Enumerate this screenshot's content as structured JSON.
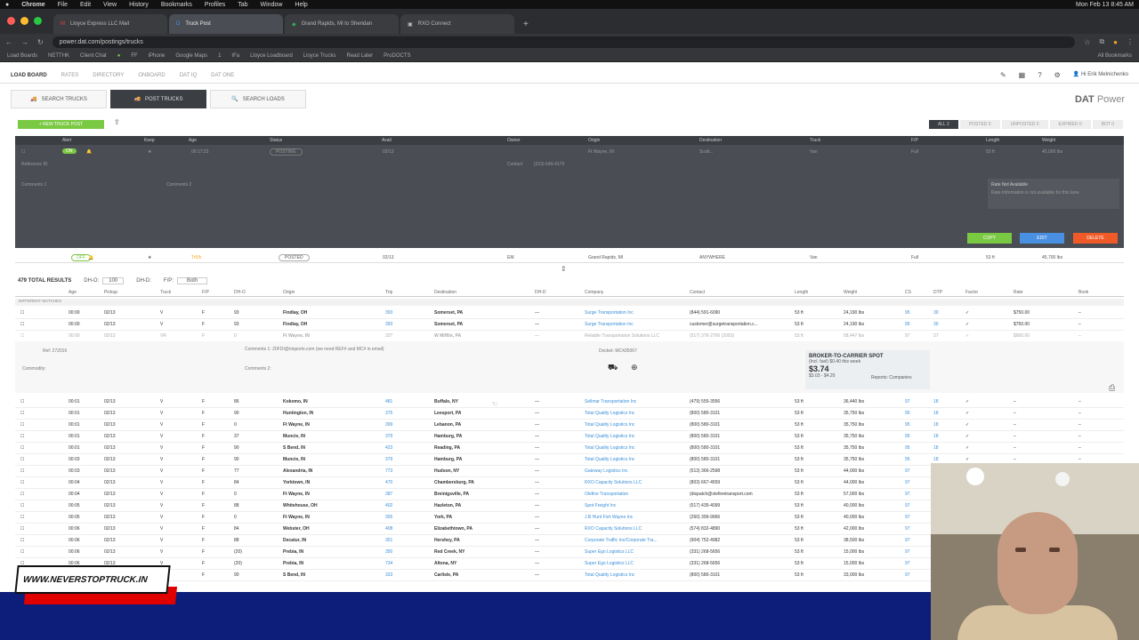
{
  "mac_menu": {
    "apple": "",
    "app": "Chrome",
    "items": [
      "File",
      "Edit",
      "View",
      "History",
      "Bookmarks",
      "Profiles",
      "Tab",
      "Window",
      "Help"
    ],
    "clock": "Mon Feb 13  8:45 AM"
  },
  "tabs": [
    {
      "label": "Lloyce Express LLC Mail",
      "active": false
    },
    {
      "label": "Truck Post",
      "active": true
    },
    {
      "label": "Grand Rapids, MI to Sheridan",
      "active": false
    },
    {
      "label": "RXO Connect",
      "active": false
    }
  ],
  "address": "power.dat.com/postings/trucks",
  "bookmarks": [
    "Load Boards",
    "NETTHK",
    "Client Chat",
    "",
    "FF",
    "iPhone",
    "Google Maps",
    "1",
    "IFa",
    "Lloyce Loadboard",
    "Lloyce Trucks",
    "Read Later",
    "ProDOCTS"
  ],
  "bookmarks_all": "All Bookmarks",
  "nav": {
    "items": [
      "LOAD BOARD",
      "RATES",
      "DIRECTORY",
      "ONBOARD",
      "DAT IQ",
      "DAT ONE"
    ],
    "user": "Hi Erik Melnichenko"
  },
  "buttons": {
    "search_trucks": "SEARCH TRUCKS",
    "post_trucks": "POST TRUCKS",
    "search_loads": "SEARCH LOADS"
  },
  "brand": {
    "name": "DAT",
    "suffix": "Power"
  },
  "new_post": "+ NEW TRUCK POST",
  "filters": [
    "ALL 2",
    "POSTED 0",
    "UNPOSTED 0",
    "EXPIRED 0",
    "BOT 0"
  ],
  "post_columns": [
    "Alert",
    "Keep",
    "Age",
    "Status",
    "Avail",
    "Owner",
    "Origin",
    "Destination",
    "Truck",
    "F/P",
    "Length",
    "Weight"
  ],
  "post1": {
    "age": "00:17:23",
    "status": "POSTING",
    "avail": "02/13",
    "contact": "Contact",
    "contact_val": "(313) 640-4179",
    "origin": "Ft Wayne, IN",
    "dest": "Scott...",
    "truck": "Van",
    "fp": "Full",
    "length": "53 ft",
    "weight": "45,000 lbs",
    "ref": "Reference ID",
    "comments1": "Comments 1",
    "comments2": "Comments 2",
    "rate_title": "Rate Not Available",
    "rate_desc": "Rate information is not available for this lane.",
    "copy": "COPY",
    "edit": "EDIT",
    "delete": "DELETE"
  },
  "post2": {
    "age": "Tr5/b",
    "status": "POSTED",
    "avail": "02/13",
    "owner": "EM",
    "origin": "Grand Rapids, MI",
    "dest": "ANYWHERE",
    "truck": "Van",
    "fp": "Full",
    "length": "53 ft",
    "weight": "45,700 lbs"
  },
  "results": {
    "total": "479 TOTAL RESULTS",
    "dho_label": "DH-O:",
    "dho_val": "100",
    "dhd_label": "DH-D:",
    "fp_label": "F/P:",
    "fp_val": "Both"
  },
  "result_columns": [
    "Age",
    "Pickup",
    "Truck",
    "F/P",
    "DH-O",
    "Origin",
    "Trip",
    "Destination",
    "DH-D",
    "Company",
    "Contact",
    "Length",
    "Weight",
    "CS",
    "DTP",
    "Factor",
    "Rate",
    "Book"
  ],
  "exact_label": "DIFFERENT MATCHES",
  "rows": [
    [
      "00:00",
      "02/13",
      "V",
      "F",
      "93",
      "Findlay, OH",
      "393",
      "Somerset, PA",
      "—",
      "Surge Transportation Inc",
      "(844) 591-6090",
      "53 ft",
      "24,190 lbs",
      "95",
      "30",
      "✓",
      "$750.00",
      "–"
    ],
    [
      "00:00",
      "02/13",
      "V",
      "F",
      "93",
      "Findlay, OH",
      "393",
      "Somerset, PA",
      "—",
      "Surge Transportation Inc",
      "customer@surgetransportation.c...",
      "53 ft",
      "24,190 lbs",
      "95",
      "30",
      "✓",
      "$750.00",
      "–"
    ],
    [
      "00:00",
      "02/13",
      "VR",
      "F",
      "0",
      "Ft Wayne, IN",
      "327",
      "W Mifflin, PA",
      "—",
      "Reliable Transportation Solutions LLC",
      "(517) 376-2700 (2093)",
      "53 ft",
      "58,447 lbs",
      "97",
      "27",
      "✓",
      "$900.00",
      "–"
    ],
    [
      "00:01",
      "02/13",
      "V",
      "F",
      "86",
      "Kokomo, IN",
      "481",
      "Buffalo, NY",
      "—",
      "Sellmar Transportation Inc",
      "(479) 555-3556",
      "53 ft",
      "36,440 lbs",
      "97",
      "18",
      "✓",
      "–",
      "–"
    ],
    [
      "00:01",
      "02/13",
      "V",
      "F",
      "90",
      "Huntington, IN",
      "375",
      "Leesport, PA",
      "—",
      "Total Quality Logistics Inc",
      "(800) 580-3101",
      "53 ft",
      "35,750 lbs",
      "95",
      "18",
      "✓",
      "–",
      "–"
    ],
    [
      "00:01",
      "02/13",
      "V",
      "F",
      "0",
      "Ft Wayne, IN",
      "399",
      "Lebanon, PA",
      "—",
      "Total Quality Logistics Inc",
      "(800) 580-3101",
      "53 ft",
      "35,750 lbs",
      "95",
      "18",
      "✓",
      "–",
      "–"
    ],
    [
      "00:01",
      "02/13",
      "V",
      "F",
      "37",
      "Muncie, IN",
      "379",
      "Hamburg, PA",
      "—",
      "Total Quality Logistics Inc",
      "(800) 580-3101",
      "53 ft",
      "35,750 lbs",
      "95",
      "18",
      "✓",
      "–",
      "–"
    ],
    [
      "00:01",
      "02/13",
      "V",
      "F",
      "90",
      "S Bend, IN",
      "423",
      "Reading, PA",
      "—",
      "Total Quality Logistics Inc",
      "(800) 580-3101",
      "53 ft",
      "35,750 lbs",
      "95",
      "18",
      "✓",
      "–",
      "–"
    ],
    [
      "00:03",
      "02/13",
      "V",
      "F",
      "90",
      "Muncie, IN",
      "379",
      "Hamburg, PA",
      "—",
      "Total Quality Logistics Inc",
      "(800) 580-3101",
      "53 ft",
      "35,750 lbs",
      "95",
      "18",
      "✓",
      "–",
      "–"
    ],
    [
      "00:03",
      "02/13",
      "V",
      "F",
      "77",
      "Alexandria, IN",
      "773",
      "Hudson, NY",
      "—",
      "Gateway Logistics Inc",
      "(513) 366-2598",
      "53 ft",
      "44,000 lbs",
      "97",
      "–",
      "✓",
      "–",
      "–"
    ],
    [
      "00:04",
      "02/13",
      "V",
      "F",
      "84",
      "Yorktown, IN",
      "470",
      "Chambersburg, PA",
      "—",
      "RXO Capacity Solutions LLC",
      "(803) 667-4559",
      "53 ft",
      "44,000 lbs",
      "97",
      "–",
      "–",
      "–",
      "–"
    ],
    [
      "00:04",
      "02/13",
      "V",
      "F",
      "0",
      "Ft Wayne, IN",
      "387",
      "Breinigsville, PA",
      "—",
      "Olefine Transportation",
      "(dispatch@olefinetransport.com",
      "53 ft",
      "57,000 lbs",
      "97",
      "–",
      "–",
      "–",
      "–"
    ],
    [
      "00:05",
      "02/13",
      "V",
      "F",
      "88",
      "Whitehouse, OH",
      "402",
      "Hazleton, PA",
      "—",
      "Spot Freight Inc",
      "(517) 435-4099",
      "53 ft",
      "40,000 lbs",
      "97",
      "–",
      "–",
      "–",
      "–"
    ],
    [
      "00:05",
      "02/13",
      "V",
      "F",
      "0",
      "Ft Wayne, IN",
      "355",
      "York, PA",
      "—",
      "J.B Hunt Fort Wayne Inc",
      "(260) 399-9966",
      "53 ft",
      "40,000 lbs",
      "97",
      "–",
      "–",
      "–",
      "–"
    ],
    [
      "00:06",
      "02/13",
      "V",
      "F",
      "84",
      "Webster, OH",
      "408",
      "Elizabethtown, PA",
      "—",
      "RXO Capacity Solutions LLC",
      "(574) 832-4890",
      "53 ft",
      "42,000 lbs",
      "97",
      "–",
      "–",
      "–",
      "–"
    ],
    [
      "00:06",
      "02/13",
      "V",
      "F",
      "88",
      "Decatur, IN",
      "351",
      "Hershey, PA",
      "—",
      "Corporate Traffic Inc/Corporate Tra...",
      "(904) 752-4982",
      "53 ft",
      "38,500 lbs",
      "97",
      "–",
      "–",
      "–",
      "–"
    ],
    [
      "00:06",
      "02/13",
      "V",
      "F",
      "(20)",
      "Prebia, IN",
      "350",
      "Red Creek, NY",
      "—",
      "Super Ego Logistics LLC",
      "(331) 268-5656",
      "53 ft",
      "15,000 lbs",
      "97",
      "–",
      "–",
      "–",
      "–"
    ],
    [
      "00:06",
      "02/13",
      "V",
      "F",
      "(20)",
      "Prebia, IN",
      "734",
      "Altona, NY",
      "—",
      "Super Ego Logistics LLC",
      "(331) 268-5656",
      "53 ft",
      "15,000 lbs",
      "97",
      "–",
      "–",
      "–",
      "–"
    ],
    [
      "00:06",
      "02/13",
      "V",
      "F",
      "90",
      "S Bend, IN",
      "333",
      "Carlisle, PA",
      "—",
      "Total Quality Logistics Inc",
      "(800) 580-3101",
      "53 ft",
      "33,000 lbs",
      "97",
      "–",
      "–",
      "–",
      "–"
    ]
  ],
  "detail": {
    "ref": "Ref: 272016",
    "comments1": "Comments 1: 20FDI@ntsports.com (we need REF# and MC# in email)",
    "docket": "Docket: MC435067",
    "commodity": "Commodity:",
    "comments2": "Comments 2:"
  },
  "spot": {
    "title": "BROKER-TO-CARRIER SPOT",
    "sub": "(Incl. fuel) $0.40 this week",
    "price": "$3.74",
    "range": "$3.03 - $4.20",
    "reports": "Reports: Companies"
  },
  "overlay": {
    "url": "WWW.NEVERSTOPTRUCK.IN"
  }
}
